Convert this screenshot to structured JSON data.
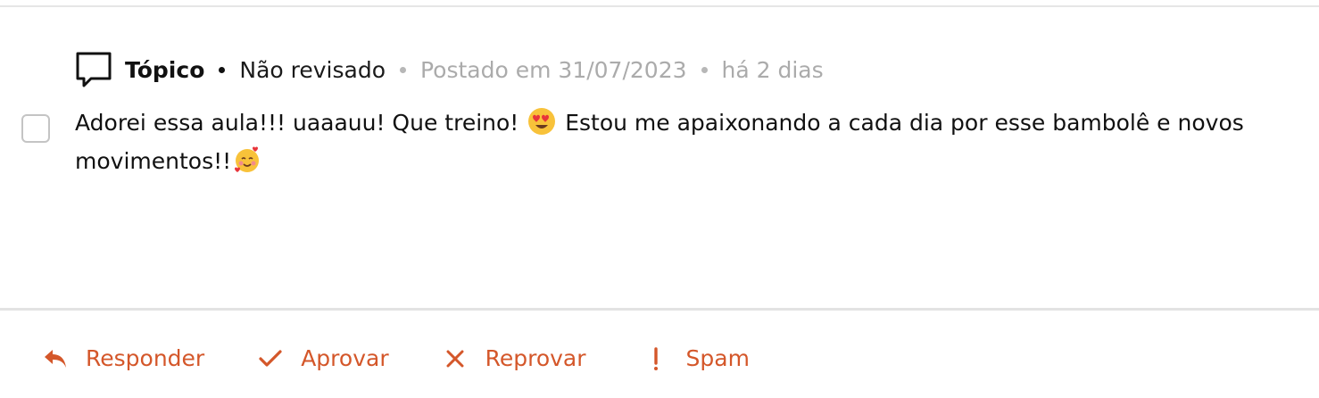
{
  "post": {
    "type_label": "Tópico",
    "status": "Não revisado",
    "posted_on": "Postado em 31/07/2023",
    "relative_time": "há 2 dias",
    "comment_part1": "Adorei essa aula!!! uaaauu! Que treino!",
    "comment_part2": "Estou me apaixonando a cada dia por esse bambolê e novos movimentos!!",
    "emojis": [
      "smiling-face-with-heart-eyes",
      "smiling-face-with-hearts"
    ]
  },
  "actions": {
    "reply": "Responder",
    "approve": "Aprovar",
    "reject": "Reprovar",
    "spam": "Spam"
  },
  "colors": {
    "accent": "#d4572a",
    "muted_text": "#ababab",
    "divider": "#e3e3e3"
  },
  "icons": [
    "chat-bubble-icon",
    "reply-icon",
    "check-icon",
    "close-icon",
    "exclamation-icon"
  ]
}
